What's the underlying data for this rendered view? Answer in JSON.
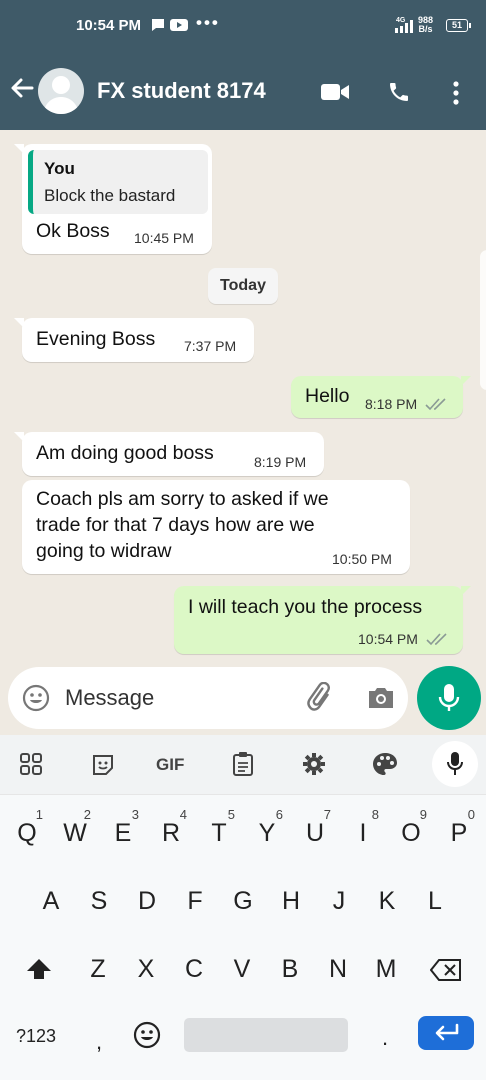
{
  "status": {
    "time": "10:54 PM",
    "dots": "•••",
    "net_speed_value": "988",
    "net_speed_unit": "B/s",
    "signal_label": "4G",
    "battery": "51"
  },
  "header": {
    "contact_name": "FX student 8174"
  },
  "messages": {
    "m1": {
      "quote_name": "You",
      "quote_text": "Block the bastard",
      "text": "Ok Boss",
      "time": "10:45 PM"
    },
    "date_chip": "Today",
    "m2": {
      "text": "Evening Boss",
      "time": "7:37 PM"
    },
    "m3": {
      "text": "Hello",
      "time": "8:18 PM"
    },
    "m4": {
      "text": "Am doing good boss",
      "time": "8:19 PM"
    },
    "m5": {
      "line1": "Coach pls am sorry to asked if we",
      "line2": "trade for that 7 days how are we",
      "line3": "going to widraw",
      "time": "10:50 PM"
    },
    "m6": {
      "text": "I will teach you the process",
      "time": "10:54 PM"
    }
  },
  "input": {
    "placeholder": "Message"
  },
  "keyboard": {
    "toolbar_gif": "GIF",
    "row1": [
      "Q",
      "W",
      "E",
      "R",
      "T",
      "Y",
      "U",
      "I",
      "O",
      "P"
    ],
    "row1_hints": [
      "1",
      "2",
      "3",
      "4",
      "5",
      "6",
      "7",
      "8",
      "9",
      "0"
    ],
    "row2": [
      "A",
      "S",
      "D",
      "F",
      "G",
      "H",
      "J",
      "K",
      "L"
    ],
    "row3": [
      "Z",
      "X",
      "C",
      "V",
      "B",
      "N",
      "M"
    ],
    "symbols_key": "?123",
    "comma_key": ",",
    "period_key": "."
  },
  "colors": {
    "header": "#3f5a68",
    "accent": "#00a884",
    "outgoing_bubble": "#dcf8c6",
    "incoming_bubble": "#ffffff",
    "chat_bg": "#efeae2",
    "enter_key": "#1e6ed8"
  }
}
